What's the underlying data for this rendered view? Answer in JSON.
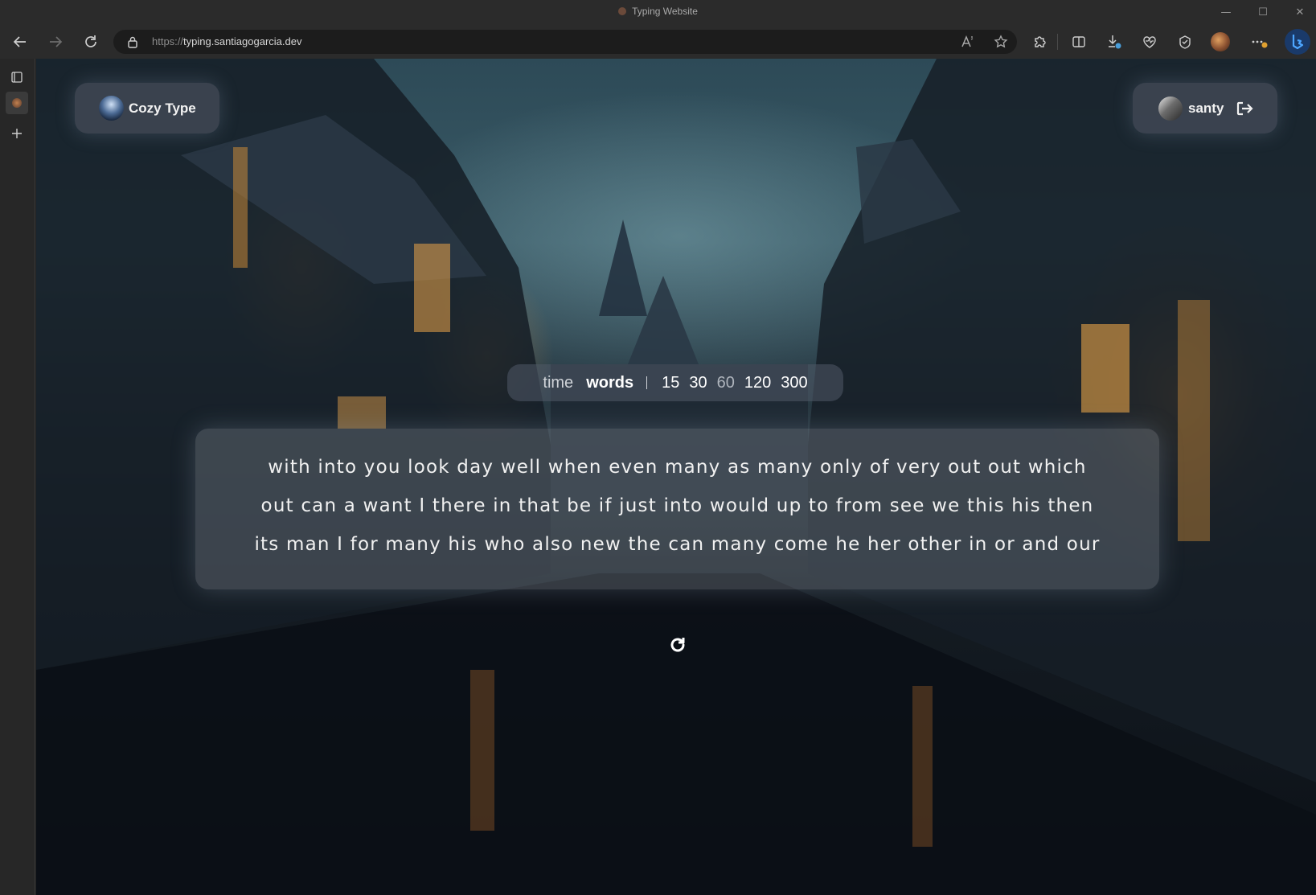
{
  "window": {
    "title": "Typing Website",
    "minimize_glyph": "—",
    "maximize_glyph": "☐",
    "close_glyph": "✕"
  },
  "address_bar": {
    "url_scheme": "https://",
    "url_host": "typing.santiagogarcia.dev"
  },
  "toolbar": {
    "icons": [
      "back-icon",
      "forward-icon",
      "refresh-icon",
      "read-aloud-icon",
      "favorite-star-icon",
      "extensions-icon",
      "split-screen-icon",
      "downloads-icon",
      "browser-essentials-icon",
      "collections-icon",
      "profile-avatar",
      "more-menu-icon",
      "copilot-icon"
    ]
  },
  "app": {
    "brand_name": "Cozy Type",
    "user_name": "santy",
    "modes": {
      "time": "time",
      "words": "words",
      "options": [
        "15",
        "30",
        "60",
        "120",
        "300"
      ]
    },
    "text_lines": [
      "with into you look day well when even many as many only of very out out which",
      "out can a want I there in that be if just into would up to from see we this his then",
      "its man I for many his who also new the can many come he her other in or and our"
    ],
    "colors": {
      "pill_bg": "#464e5c",
      "text": "#f1f1f1",
      "accent_lamp": "#eb963c"
    }
  }
}
